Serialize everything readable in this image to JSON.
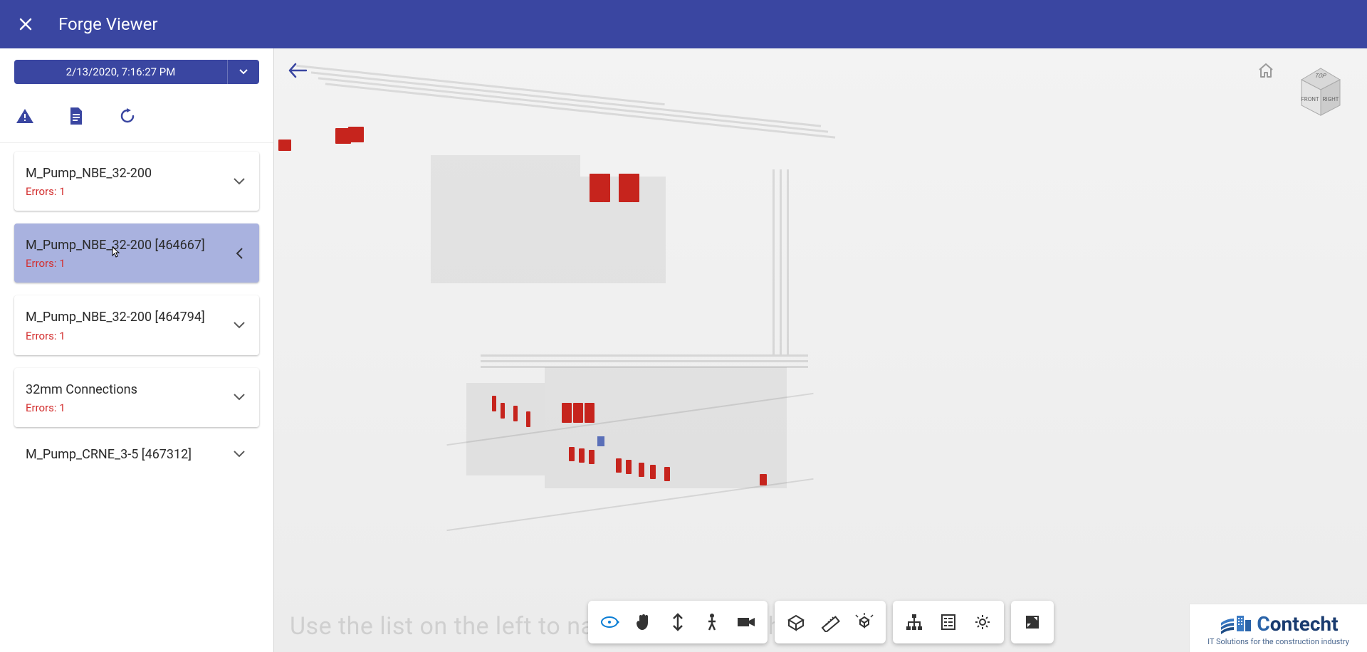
{
  "header": {
    "title": "Forge Viewer"
  },
  "sidebar": {
    "date_label": "2/13/2020, 7:16:27 PM",
    "items": [
      {
        "title": "M_Pump_NBE_32-200",
        "errors": "Errors: 1",
        "selected": false
      },
      {
        "title": "M_Pump_NBE_32-200 [464667]",
        "errors": "Errors: 1",
        "selected": true
      },
      {
        "title": "M_Pump_NBE_32-200 [464794]",
        "errors": "Errors: 1",
        "selected": false
      },
      {
        "title": "32mm Connections",
        "errors": "Errors: 1",
        "selected": false
      },
      {
        "title": "M_Pump_CRNE_3-5 [467312]",
        "errors": "",
        "selected": false
      }
    ]
  },
  "watermark_text": "Use the list on the left to navigate through the issues",
  "viewcube": {
    "top": "TOP",
    "front": "FRONT",
    "right": "RIGHT"
  },
  "logo": {
    "brand_c": "C",
    "brand_rest": "ontecht",
    "tagline": "IT Solutions for the construction industry"
  }
}
